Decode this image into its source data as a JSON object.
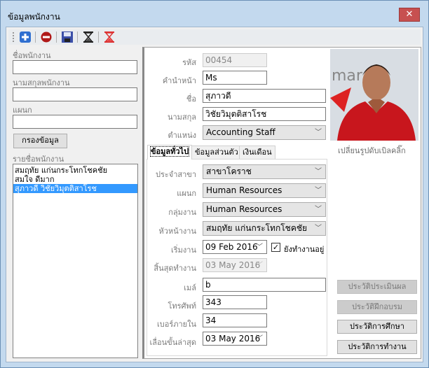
{
  "window": {
    "title": "ข้อมูลพนักงาน",
    "close": "✕"
  },
  "toolbar": {
    "icons": [
      "add-icon",
      "delete-icon",
      "save-icon",
      "hourglass-icon",
      "hourglass-red-icon"
    ]
  },
  "filter": {
    "first_name_label": "ชื่อพนักงาน",
    "first_name_value": "",
    "last_name_label": "นามสกุลพนักงาน",
    "last_name_value": "",
    "department_label": "แผนก",
    "department_value": "",
    "filter_button": "กรองข้อมูล",
    "list_label": "รายชื่อพนักงาน",
    "employees": [
      "สมฤทัย แก่นกระโทกโชคชัย",
      "สมใจ ดีมาก",
      "สุภาวดี วิชัยวิมุตติสาโรช"
    ],
    "selected_index": 2
  },
  "detail": {
    "id_label": "รหัส",
    "id_value": "00454",
    "prefix_label": "คำนำหน้า",
    "prefix_value": "Ms",
    "name_label": "ชื่อ",
    "name_value": "สุภาวดี",
    "surname_label": "นามสกุล",
    "surname_value": "วิชัยวิมุตติสาโรช",
    "position_label": "ตำแหน่ง",
    "position_value": "Accounting Staff",
    "photo_hint": "เปลี่ยนรูปดับเบิลคลิ๊ก"
  },
  "tabs": [
    "ข้อมูลทั่วไป",
    "ข้อมูลส่วนตัว",
    "เงินเดือน"
  ],
  "general": {
    "branch_label": "ประจำสาขา",
    "branch_value": "สาขาโคราช",
    "dept_label": "แผนก",
    "dept_value": "Human Resources",
    "group_label": "กลุ่มงาน",
    "group_value": "Human Resources",
    "head_label": "หัวหน้างาน",
    "head_value": "สมฤทัย แก่นกระโทกโชคชัย",
    "start_label": "เริ่มงาน",
    "start_value": "09 Feb 2016",
    "still_working_label": "ยังทำงานอยู่",
    "still_working": true,
    "end_label": "สิ้นสุดทำงาน",
    "end_value": "03 May 2016",
    "email_label": "เมล์",
    "email_value": "b",
    "phone_label": "โทรศัพท์",
    "phone_value": "343",
    "ext_label": "เบอร์ภายใน",
    "ext_value": "34",
    "promo_label": "เลื่อนขั้นล่าสุด",
    "promo_value": "03 May 2016"
  },
  "history_buttons": [
    "ประวัติประเมินผล",
    "ประวัติฝึกอบรม",
    "ประวัติการศึกษา",
    "ประวัติการทำงาน"
  ]
}
